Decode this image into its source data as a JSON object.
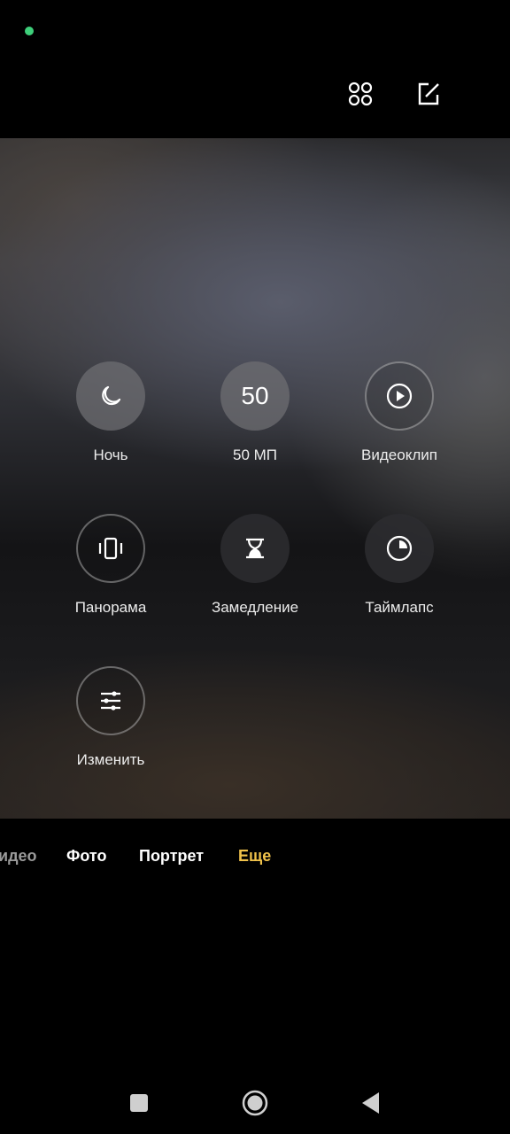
{
  "status": {
    "indicator_color": "#3ecf7a"
  },
  "toolbar": {
    "grid_icon": "four-dots-icon",
    "edit_icon": "edit-square-icon"
  },
  "modes": [
    {
      "label": "Ночь",
      "icon": "moon-icon"
    },
    {
      "label": "50 МП",
      "icon_text": "50"
    },
    {
      "label": "Видеоклип",
      "icon": "play-circle-icon"
    },
    {
      "label": "Панорама",
      "icon": "panorama-icon"
    },
    {
      "label": "Замедление",
      "icon": "hourglass-icon"
    },
    {
      "label": "Таймлапс",
      "icon": "timer-icon"
    },
    {
      "label": "Изменить",
      "icon": "sliders-icon"
    }
  ],
  "mode_bar": {
    "items": [
      "идео",
      "Фото",
      "Портрет",
      "Еще"
    ],
    "active_color": "#f0c24b"
  },
  "nav": {
    "square": "recent-apps-icon",
    "circle": "home-icon",
    "triangle": "back-icon"
  }
}
